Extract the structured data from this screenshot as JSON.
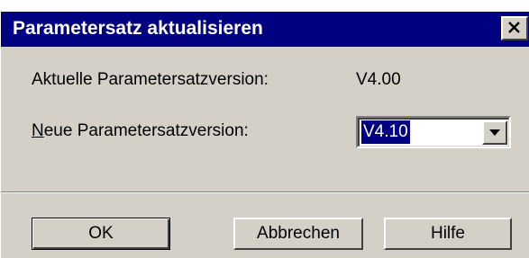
{
  "window": {
    "title": "Parametersatz aktualisieren",
    "close_glyph": "close-icon"
  },
  "form": {
    "current_label": "Aktuelle Parametersatzversion:",
    "current_value": "V4.00",
    "new_label_mnemonic": "N",
    "new_label_rest": "eue Parametersatzversion:",
    "new_value": "V4.10"
  },
  "buttons": {
    "ok": "OK",
    "cancel": "Abbrechen",
    "help": "Hilfe"
  },
  "colors": {
    "titlebar": "#000080",
    "face": "#d4d0c8",
    "selection": "#000080"
  }
}
